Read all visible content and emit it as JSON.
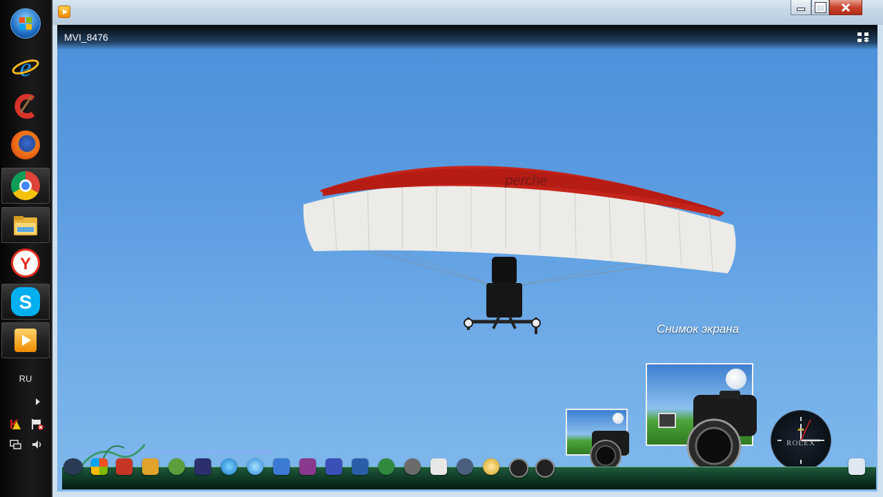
{
  "taskbar": {
    "items": [
      {
        "name": "windows-start-button",
        "icon": "windows-orb-icon"
      },
      {
        "name": "internet-explorer",
        "icon": "internet-explorer-icon"
      },
      {
        "name": "ccleaner",
        "icon": "ccleaner-icon"
      },
      {
        "name": "firefox",
        "icon": "firefox-icon"
      },
      {
        "name": "chrome",
        "icon": "chrome-icon"
      },
      {
        "name": "file-explorer",
        "icon": "folder-icon"
      },
      {
        "name": "yandex-browser",
        "icon": "yandex-icon"
      },
      {
        "name": "skype",
        "icon": "skype-icon"
      },
      {
        "name": "media-player",
        "icon": "media-player-icon"
      }
    ],
    "language": "RU",
    "tray_icons": [
      "kaspersky-icon",
      "action-center-flag-icon",
      "network-icon",
      "volume-icon"
    ]
  },
  "window": {
    "title_bar": {
      "minimize_icon": "minimize-icon",
      "maximize_icon": "maximize-icon",
      "close_icon": "close-icon"
    },
    "video": {
      "title": "MVI_8476",
      "fullscreen_icon": "exit-fullscreen-icon"
    }
  },
  "desktop_widgets": {
    "snapshot_label": "Снимок экрана",
    "clock_brand": "ROLEX"
  },
  "colors": {
    "sky": "#5a9be0",
    "wing_red": "#c4251b",
    "wing_white": "#ecebe8",
    "dock_green": "#1f5a3b"
  }
}
